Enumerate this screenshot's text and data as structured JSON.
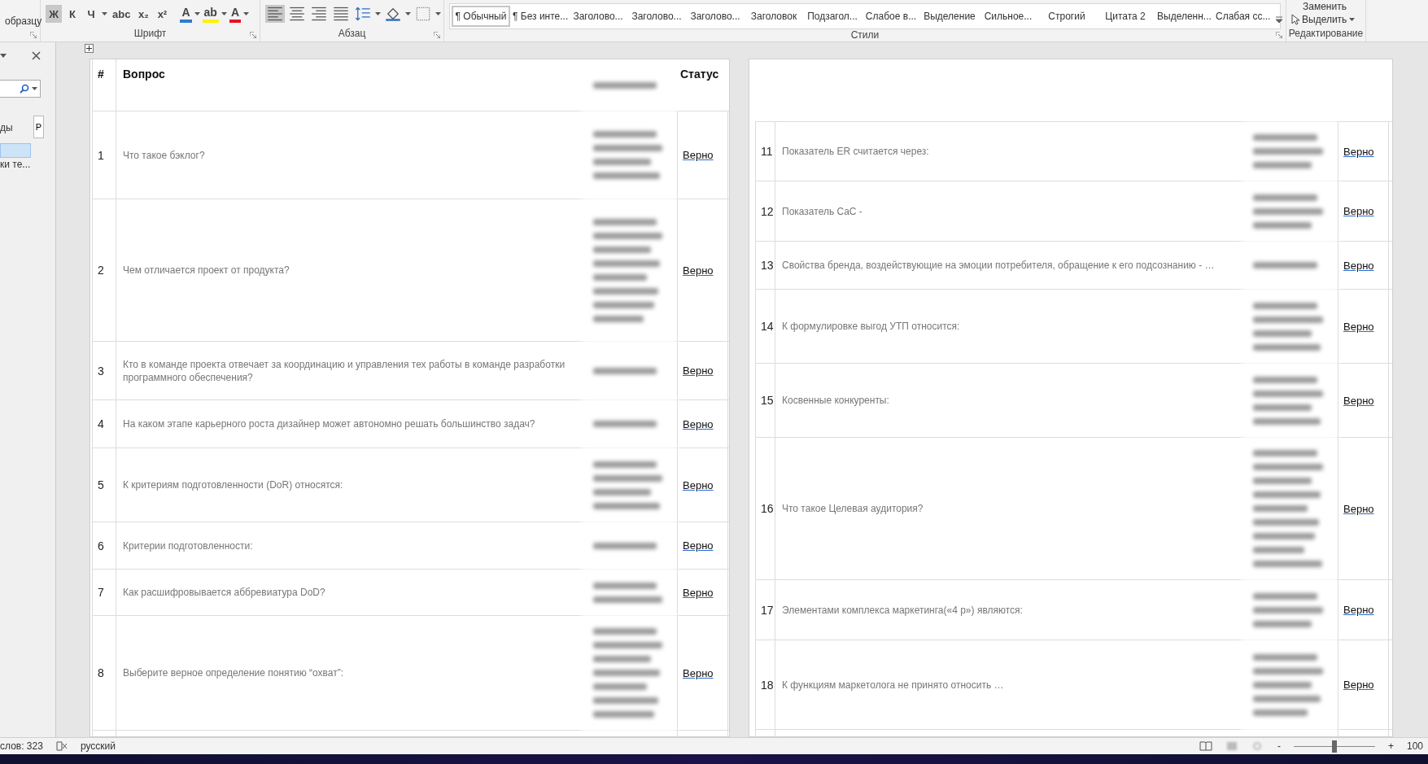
{
  "ribbon": {
    "clipboard_fragment": "образцу",
    "font_group": {
      "label": "Шрифт",
      "toggles": [
        {
          "label": "Ж",
          "selected": true
        },
        {
          "label": "К",
          "selected": false
        },
        {
          "label": "Ч",
          "selected": false
        },
        {
          "label": "abc",
          "selected": false
        },
        {
          "label": "x₂",
          "selected": false
        },
        {
          "label": "x²",
          "selected": false
        }
      ],
      "color_buttons": [
        {
          "label": "A",
          "color": "#2f7ad1"
        },
        {
          "label": "ab",
          "color": "#fff200"
        },
        {
          "label": "A",
          "color": "#e81123"
        }
      ]
    },
    "paragraph_group": {
      "label": "Абзац",
      "alignments": [
        {
          "selected": true
        },
        {
          "selected": false
        },
        {
          "selected": false
        },
        {
          "selected": false
        }
      ]
    },
    "styles_group": {
      "label": "Стили",
      "items": [
        {
          "label": "¶ Обычный",
          "selected": true
        },
        {
          "label": "¶ Без инте...",
          "selected": false
        },
        {
          "label": "Заголово...",
          "selected": false
        },
        {
          "label": "Заголово...",
          "selected": false
        },
        {
          "label": "Заголово...",
          "selected": false
        },
        {
          "label": "Заголовок",
          "selected": false
        },
        {
          "label": "Подзагол...",
          "selected": false
        },
        {
          "label": "Слабое в...",
          "selected": false
        },
        {
          "label": "Выделение",
          "selected": false
        },
        {
          "label": "Сильное...",
          "selected": false
        },
        {
          "label": "Строгий",
          "selected": false
        },
        {
          "label": "Цитата 2",
          "selected": false
        },
        {
          "label": "Выделенн...",
          "selected": false
        },
        {
          "label": "Слабая сс...",
          "selected": false
        }
      ]
    },
    "editing_group": {
      "label": "Редактирование",
      "replace": "Заменить",
      "select": "Выделить"
    }
  },
  "nav_pane": {
    "tab_fragment": "ды",
    "tab_button": "Р",
    "item_fragment": "ки те..."
  },
  "table_left": {
    "columns": [
      "#",
      "Вопрос",
      "Статус"
    ],
    "rows": [
      {
        "number": "1",
        "question": "Что такое бэклог?",
        "status": "Верно"
      },
      {
        "number": "2",
        "question": "Чем отличается проект от продукта?",
        "status": "Верно"
      },
      {
        "number": "3",
        "question": "Кто в команде проекта отвечает за координацию и управления тех работы в команде разработки программного обеспечения?",
        "status": "Верно"
      },
      {
        "number": "4",
        "question": "На каком этапе карьерного роста дизайнер может автономно решать большинство задач?",
        "status": "Верно"
      },
      {
        "number": "5",
        "question": "К критериям подготовленности (DoR) относятся:",
        "status": "Верно"
      },
      {
        "number": "6",
        "question": "Критерии подготовленности:",
        "status": "Верно"
      },
      {
        "number": "7",
        "question": "Как расшифровывается аббревиатура DoD?",
        "status": "Верно"
      },
      {
        "number": "8",
        "question": "Выберите верное определение понятию “охват”:",
        "status": "Верно"
      }
    ]
  },
  "table_right": {
    "rows": [
      {
        "number": "11",
        "question": "Показатель ER считается через:",
        "status": "Верно"
      },
      {
        "number": "12",
        "question": "Показатель CaC -",
        "status": "Верно"
      },
      {
        "number": "13",
        "question": "Свойства бренда, воздействующие на эмоции потребителя, обращение к его подсознанию - …",
        "status": "Верно"
      },
      {
        "number": "14",
        "question": "К формулировке выгод УТП относится:",
        "status": "Верно"
      },
      {
        "number": "15",
        "question": "Косвенные конкуренты:",
        "status": "Верно"
      },
      {
        "number": "16",
        "question": "Что такое Целевая аудитория?",
        "status": "Верно"
      },
      {
        "number": "17",
        "question": "Элементами комплекса маркетинга(«4 р») являются:",
        "status": "Верно"
      },
      {
        "number": "18",
        "question": "К функциям маркетолога не принято относить …",
        "status": "Верно"
      }
    ]
  },
  "status_bar": {
    "word_count": "слов: 323",
    "language": "русский",
    "zoom_minus": "-",
    "zoom_plus": "+",
    "zoom": "100",
    "zoom_slider": {
      "level": 0.5
    }
  }
}
